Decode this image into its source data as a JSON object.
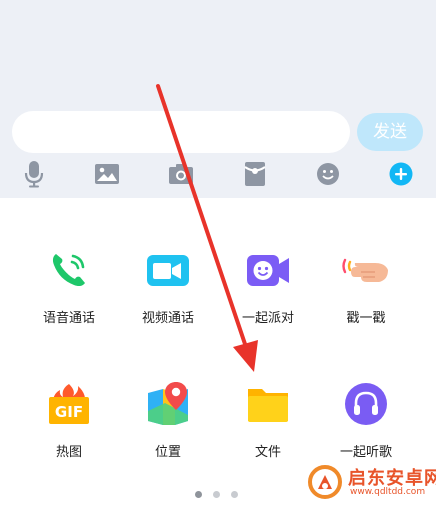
{
  "input": {
    "send_label": "发送",
    "placeholder": ""
  },
  "toolbar": {
    "items": [
      "microphone-icon",
      "image-icon",
      "camera-icon",
      "red-packet-icon",
      "emoji-icon",
      "plus-icon"
    ],
    "accent": "#12b7f5"
  },
  "apps": [
    {
      "label": "语音通话",
      "icon": "phone-icon",
      "color": "#1ec76a"
    },
    {
      "label": "视频通话",
      "icon": "video-camera-icon",
      "color": "#1fc2f0"
    },
    {
      "label": "一起派对",
      "icon": "party-icon",
      "color": "#7b5cf5"
    },
    {
      "label": "戳一戳",
      "icon": "poke-finger-icon",
      "color": "#f4b28c"
    },
    {
      "label": "热图",
      "icon": "gif-icon",
      "color": "#ff8a1c"
    },
    {
      "label": "位置",
      "icon": "map-pin-icon",
      "color": "#f24b4b"
    },
    {
      "label": "文件",
      "icon": "folder-icon",
      "color": "#ffc400"
    },
    {
      "label": "一起听歌",
      "icon": "headphones-icon",
      "color": "#7a5cf3"
    }
  ],
  "pager": {
    "current": 1,
    "total": 3
  },
  "annotation": {
    "arrow_color": "#e8332a"
  },
  "watermark": {
    "title": "启东安卓网",
    "url": "www.qdltdd.com"
  }
}
